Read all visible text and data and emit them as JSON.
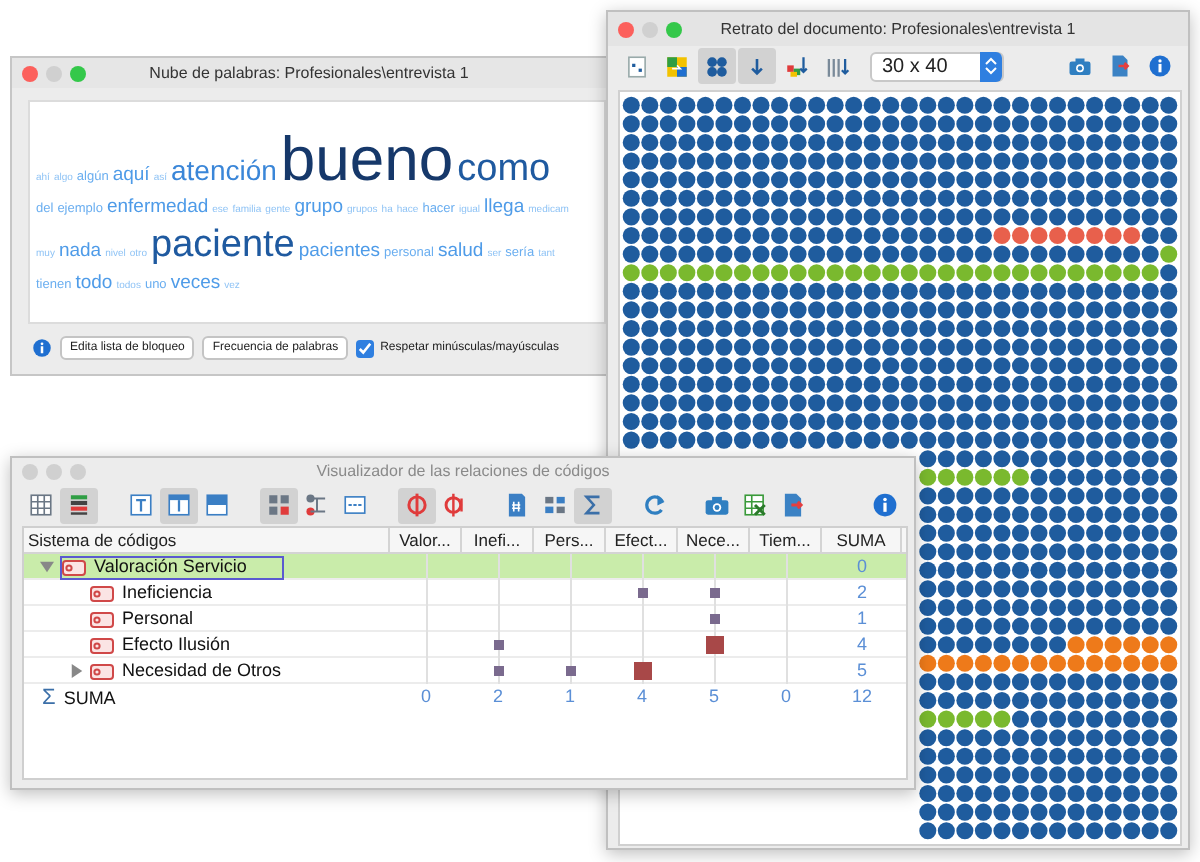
{
  "word_cloud_window": {
    "title": "Nube de palabras: Profesionales\\entrevista 1",
    "cloud_lines": [
      [
        {
          "text": "ahí",
          "kind": "xs"
        },
        {
          "text": "algo",
          "kind": "xs"
        },
        {
          "text": "algún",
          "kind": "sm"
        },
        {
          "text": "aquí",
          "kind": "md"
        },
        {
          "text": "así",
          "kind": "xs"
        },
        {
          "text": "atención",
          "kind": "lg"
        },
        {
          "text": "bueno",
          "kind": "xxl"
        },
        {
          "text": "como",
          "kind": "xl"
        }
      ],
      [
        {
          "text": "del",
          "kind": "sm"
        },
        {
          "text": "ejemplo",
          "kind": "sm"
        },
        {
          "text": "enfermedad",
          "kind": "md"
        },
        {
          "text": "ese",
          "kind": "xs"
        },
        {
          "text": "familia",
          "kind": "xs"
        },
        {
          "text": "gente",
          "kind": "xs"
        },
        {
          "text": "grupo",
          "kind": "md"
        },
        {
          "text": "grupos",
          "kind": "xs"
        },
        {
          "text": "ha",
          "kind": "xs"
        },
        {
          "text": "hace",
          "kind": "xs"
        },
        {
          "text": "hacer",
          "kind": "sm"
        },
        {
          "text": "igual",
          "kind": "xs"
        },
        {
          "text": "llega",
          "kind": "md"
        },
        {
          "text": "medicam",
          "kind": "xs"
        }
      ],
      [
        {
          "text": "muy",
          "kind": "xs"
        },
        {
          "text": "nada",
          "kind": "md"
        },
        {
          "text": "nivel",
          "kind": "xs"
        },
        {
          "text": "otro",
          "kind": "xs"
        },
        {
          "text": "paciente",
          "kind": "xl"
        },
        {
          "text": "pacientes",
          "kind": "md"
        },
        {
          "text": "personal",
          "kind": "sm"
        },
        {
          "text": "salud",
          "kind": "md"
        },
        {
          "text": "ser",
          "kind": "xs"
        },
        {
          "text": "sería",
          "kind": "sm"
        },
        {
          "text": "tant",
          "kind": "xs"
        }
      ],
      [
        {
          "text": "tienen",
          "kind": "sm"
        },
        {
          "text": "todo",
          "kind": "md"
        },
        {
          "text": "todos",
          "kind": "xs"
        },
        {
          "text": "uno",
          "kind": "sm"
        },
        {
          "text": "veces",
          "kind": "md"
        },
        {
          "text": "vez",
          "kind": "xs"
        }
      ]
    ],
    "buttons": [
      "Edita lista de bloqueo",
      "Frecuencia de palabras"
    ],
    "checkbox": {
      "label": "Respetar minúsculas/mayúsculas",
      "checked": true
    }
  },
  "portrait_window": {
    "title": "Retrato del documento: Profesionales\\entrevista 1",
    "toolbar": [
      {
        "selected": false
      },
      {
        "selected": false
      },
      {
        "selected": true
      },
      {
        "selected": true
      },
      {
        "selected": false
      },
      {
        "selected": false
      }
    ],
    "grid_size": {
      "value": "30 x 40"
    }
  },
  "relations_window": {
    "title": "Visualizador de las relaciones de códigos",
    "toolbar": [
      {
        "selected": false
      },
      {
        "selected": true
      },
      {
        "selected": false
      },
      {
        "selected": true
      },
      {
        "selected": false
      },
      {
        "selected": true
      },
      {
        "selected": false
      },
      {
        "selected": false
      },
      {
        "selected": true
      },
      {
        "selected": false
      },
      {
        "selected": false
      },
      {
        "selected": false
      },
      {
        "selected": true
      },
      {
        "selected": false
      },
      {
        "selected": false
      },
      {
        "selected": false
      },
      {
        "selected": false
      },
      {
        "selected": false
      }
    ],
    "columns": [
      "Sistema de códigos",
      "Valor...",
      "Inefi...",
      "Pers...",
      "Efect...",
      "Nece...",
      "Tiem...",
      "SUMA"
    ],
    "codes": [
      {
        "name": "Valoración Servicio",
        "expanded": true,
        "selected": true,
        "cells": [
          {
            "kind": "empty"
          },
          {
            "kind": "empty"
          },
          {
            "kind": "empty"
          },
          {
            "kind": "empty"
          },
          {
            "kind": "empty"
          },
          {
            "kind": "empty"
          }
        ],
        "sum": "0",
        "children": [
          {
            "name": "Ineficiencia",
            "selected": false,
            "cells": [
              {
                "kind": "empty"
              },
              {
                "kind": "empty"
              },
              {
                "kind": "empty"
              },
              {
                "kind": "small"
              },
              {
                "kind": "small"
              },
              {
                "kind": "empty"
              }
            ],
            "sum": "2"
          },
          {
            "name": "Personal",
            "selected": false,
            "cells": [
              {
                "kind": "empty"
              },
              {
                "kind": "empty"
              },
              {
                "kind": "empty"
              },
              {
                "kind": "empty"
              },
              {
                "kind": "small"
              },
              {
                "kind": "empty"
              }
            ],
            "sum": "1"
          },
          {
            "name": "Efecto Ilusión",
            "selected": false,
            "cells": [
              {
                "kind": "empty"
              },
              {
                "kind": "small"
              },
              {
                "kind": "empty"
              },
              {
                "kind": "empty"
              },
              {
                "kind": "large"
              },
              {
                "kind": "empty"
              }
            ],
            "sum": "4"
          },
          {
            "name": "Necesidad de Otros",
            "expanded": false,
            "selected": false,
            "cells": [
              {
                "kind": "empty"
              },
              {
                "kind": "small"
              },
              {
                "kind": "small"
              },
              {
                "kind": "large"
              },
              {
                "kind": "empty"
              },
              {
                "kind": "empty"
              }
            ],
            "sum": "5"
          }
        ]
      }
    ],
    "sum_row": {
      "symbol": "Σ",
      "label": "SUMA",
      "values": [
        "0",
        "2",
        "1",
        "4",
        "5",
        "0",
        "12"
      ]
    }
  }
}
